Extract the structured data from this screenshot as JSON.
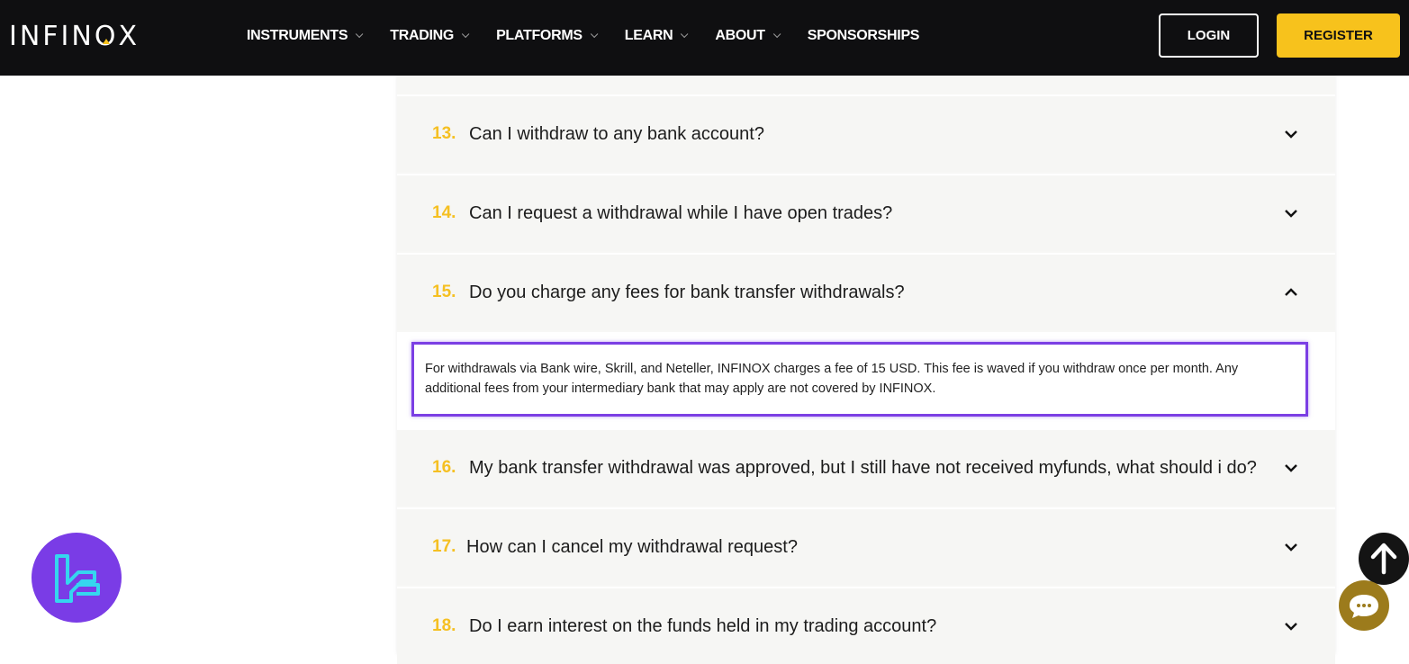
{
  "header": {
    "logo_text": "INFINOX",
    "nav": [
      {
        "label": "INSTRUMENTS",
        "has_dropdown": true
      },
      {
        "label": "TRADING",
        "has_dropdown": true
      },
      {
        "label": "PLATFORMS",
        "has_dropdown": true
      },
      {
        "label": "LEARN",
        "has_dropdown": true
      },
      {
        "label": "ABOUT",
        "has_dropdown": true
      },
      {
        "label": "SPONSORSHIPS",
        "has_dropdown": false
      }
    ],
    "login_label": "LOGIN",
    "register_label": "REGISTER",
    "accent_color": "#f7c21c"
  },
  "faq": {
    "items": [
      {
        "num": "13.",
        "question": "Can I withdraw to any bank account?",
        "expanded": false
      },
      {
        "num": "14.",
        "question": "Can I request a withdrawal while I have open trades?",
        "expanded": false
      },
      {
        "num": "15.",
        "question": "Do you charge any fees for bank transfer withdrawals?",
        "expanded": true
      },
      {
        "num": "16.",
        "question": "My bank transfer withdrawal was approved, but I still have not received myfunds, what should i do?",
        "expanded": false
      },
      {
        "num": "17.",
        "question": "How can I cancel my withdrawal request?",
        "expanded": false
      },
      {
        "num": "18.",
        "question": "Do I earn interest on the funds held in my trading account?",
        "expanded": false
      }
    ],
    "answer_15": "For withdrawals via Bank wire, Skrill, and Neteller, INFINOX charges a fee of 15 USD. This fee is waved if you withdraw once per month. Any additional fees from your intermediary bank that may apply are not covered by INFINOX.",
    "highlight_color": "#7b3fe4"
  },
  "floating": {
    "badge_icon": "brand-logo-icon",
    "scroll_top_icon": "arrow-up-icon",
    "chat_icon": "chat-bubble-icon"
  }
}
